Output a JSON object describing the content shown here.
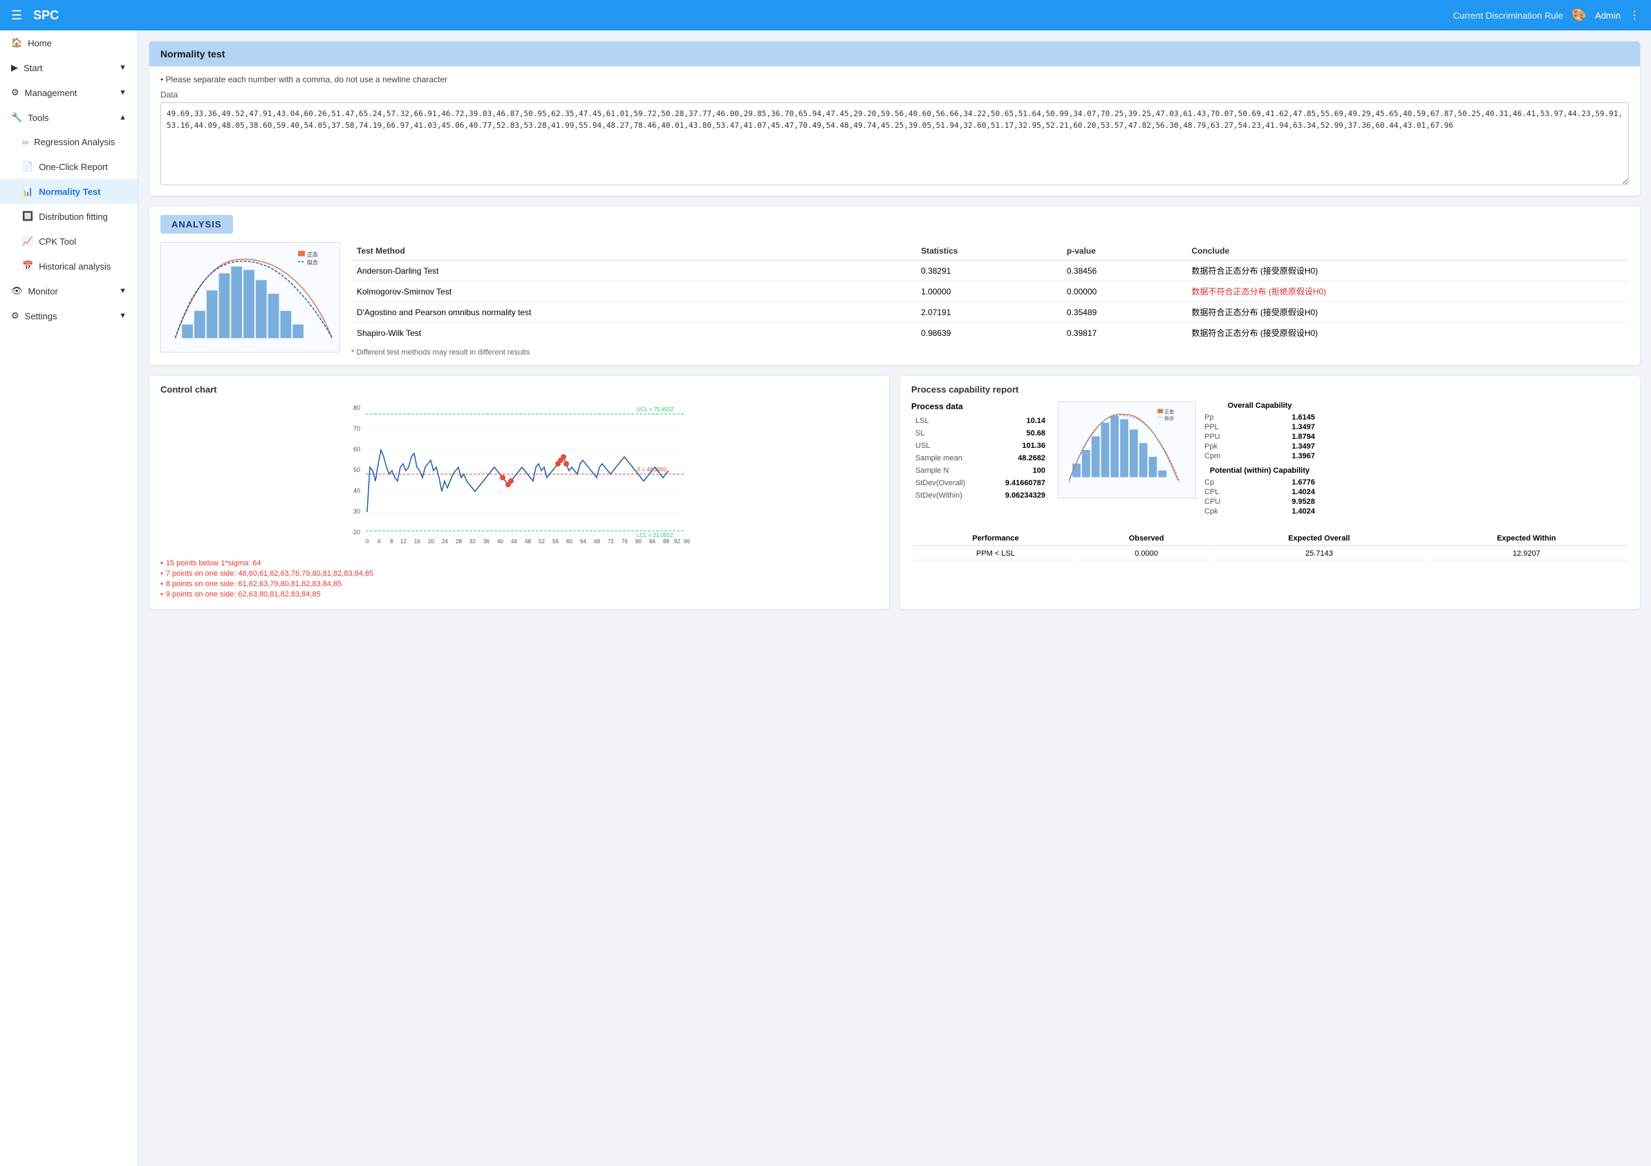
{
  "header": {
    "menu_icon": "☰",
    "title": "SPC",
    "rule": "Current Discrimination Rule",
    "user": "Admin",
    "palette_icon": "🎨"
  },
  "sidebar": {
    "items": [
      {
        "id": "home",
        "label": "Home",
        "icon": "🏠",
        "indent": 0,
        "expandable": false
      },
      {
        "id": "start",
        "label": "Start",
        "icon": "▶",
        "indent": 0,
        "expandable": true
      },
      {
        "id": "management",
        "label": "Management",
        "icon": "⚙",
        "indent": 0,
        "expandable": true
      },
      {
        "id": "tools",
        "label": "Tools",
        "icon": "🔧",
        "indent": 0,
        "expandable": true,
        "expanded": true
      },
      {
        "id": "regression",
        "label": "Regression Analysis",
        "icon": "∞",
        "indent": 1
      },
      {
        "id": "oneclick",
        "label": "One-Click Report",
        "icon": "📄",
        "indent": 1
      },
      {
        "id": "normality",
        "label": "Normality Test",
        "icon": "📊",
        "indent": 1,
        "active": true
      },
      {
        "id": "distribution",
        "label": "Distribution fitting",
        "icon": "🔲",
        "indent": 1
      },
      {
        "id": "cpk",
        "label": "CPK Tool",
        "icon": "📈",
        "indent": 1
      },
      {
        "id": "historical",
        "label": "Historical analysis",
        "icon": "📅",
        "indent": 1
      },
      {
        "id": "monitor",
        "label": "Monitor",
        "icon": "👁",
        "indent": 0,
        "expandable": true
      },
      {
        "id": "settings",
        "label": "Settings",
        "icon": "⚙",
        "indent": 0,
        "expandable": true
      }
    ]
  },
  "normality_test": {
    "title": "Normality test",
    "hint": "Please separate each number with a comma, do not use a newline character",
    "data_label": "Data",
    "data_value": "49.69,33.36,49.52,47.91,43.04,60.26,51.47,65.24,57.32,66.91,46.72,39.03,46.87,50.95,62.35,47.45,61.01,59.72,50.28,37.77,46.00,29.85,36.70,65.94,47.45,29.20,59.56,40.60,56.66,34.22,50.65,51.64,50.99,34.07,70.25,39.25,47.03,61.43,70.07,50.69,41.62,47.85,55.69,49.29,45.65,40.59,67.87,50.25,40.31,46.41,53.97,44.23,59.91,53.16,44.09,48.05,38.60,59.40,54.05,37.58,74.19,66.97,41.03,45.06,40.77,52.83,53.28,41.99,55.94,48.27,78.46,40.01,43.80,53.47,41.07,45.47,70.49,54.48,49.74,45.25,39.05,51.94,32.60,51.17,32.95,52.21,60.20,53.57,47.82,56.30,48.79,63.27,54.23,41.94,63.34,52.99,37.36,60.44,43.01,67.96"
  },
  "analysis": {
    "header": "ANALYSIS",
    "table": {
      "columns": [
        "Test Method",
        "Statistics",
        "p-value",
        "Conclude"
      ],
      "rows": [
        {
          "method": "Anderson-Darling Test",
          "stats": "0.38291",
          "pvalue": "0.38456",
          "conclude": "数据符合正态分布 (接受原假设H0)",
          "red": false
        },
        {
          "method": "Kolmogorov-Smirnov Test",
          "stats": "1.00000",
          "pvalue": "0.00000",
          "conclude": "数据不符合正态分布 (拒绝原假设H0)",
          "red": true
        },
        {
          "method": "D'Agostino and Pearson omnibus normality test",
          "stats": "2.07191",
          "pvalue": "0.35489",
          "conclude": "数据符合正态分布 (接受原假设H0)",
          "red": false
        },
        {
          "method": "Shapiro-Wilk Test",
          "stats": "0.98639",
          "pvalue": "0.39817",
          "conclude": "数据符合正态分布 (接受原假设H0)",
          "red": false
        }
      ]
    },
    "footnote": "* Different test methods may result in different results"
  },
  "control_chart": {
    "title": "Control chart",
    "ucl_label": "UCL = 75.4552",
    "lcl_label": "LCL = 21.0812",
    "mean_label": "X̄ = 48.2682",
    "ucl_val": 75.4552,
    "lcl_val": 21.0812,
    "mean_val": 48.2682,
    "y_min": 20,
    "y_max": 80,
    "y_ticks": [
      20,
      30,
      40,
      50,
      60,
      70,
      80
    ],
    "x_ticks": [
      0,
      4,
      8,
      12,
      16,
      20,
      24,
      28,
      32,
      36,
      40,
      44,
      48,
      52,
      56,
      60,
      64,
      68,
      72,
      76,
      80,
      84,
      88,
      92,
      96
    ],
    "alerts": [
      "15 points below 1*sigma: 64",
      "7 points on one side: 48,60,61,62,63,78,79,80,81,82,83,84,85",
      "8 points on one side: 61,62,63,79,80,81,82,83,84,85",
      "9 points on one side: 62,63,80,81,82,83,84,85"
    ]
  },
  "process_capability": {
    "title": "Process capability report",
    "process_data": {
      "label": "Process data",
      "rows": [
        {
          "key": "LSL",
          "val": "10.14"
        },
        {
          "key": "SL",
          "val": "50.68"
        },
        {
          "key": "USL",
          "val": "101.36"
        },
        {
          "key": "Sample mean",
          "val": "48.2682"
        },
        {
          "key": "Sample N",
          "val": "100"
        },
        {
          "key": "StDev(Overall)",
          "val": "9.41660787"
        },
        {
          "key": "StDev(Within)",
          "val": "9.06234329"
        }
      ]
    },
    "overall": {
      "title": "Overall Capability",
      "rows": [
        {
          "label": "Pp",
          "val": "1.6145"
        },
        {
          "label": "PPL",
          "val": "1.3497"
        },
        {
          "label": "PPU",
          "val": "1.8794"
        },
        {
          "label": "Ppk",
          "val": "1.3497"
        },
        {
          "label": "Cpm",
          "val": "1.3967"
        }
      ]
    },
    "potential": {
      "title": "Potential (within) Capability",
      "rows": [
        {
          "label": "Cp",
          "val": "1.6776"
        },
        {
          "label": "CPL",
          "val": "1.4024"
        },
        {
          "label": "CPU",
          "val": "9.9528"
        },
        {
          "label": "Cpk",
          "val": "1.4024"
        }
      ]
    },
    "performance": {
      "title": "Performance",
      "columns": [
        "",
        "Observed",
        "Expected Overall",
        "Expected Within"
      ],
      "rows": [
        {
          "label": "PPM < LSL",
          "observed": "0.0000",
          "exp_overall": "25.7143",
          "exp_within": "12.9207"
        }
      ]
    }
  }
}
